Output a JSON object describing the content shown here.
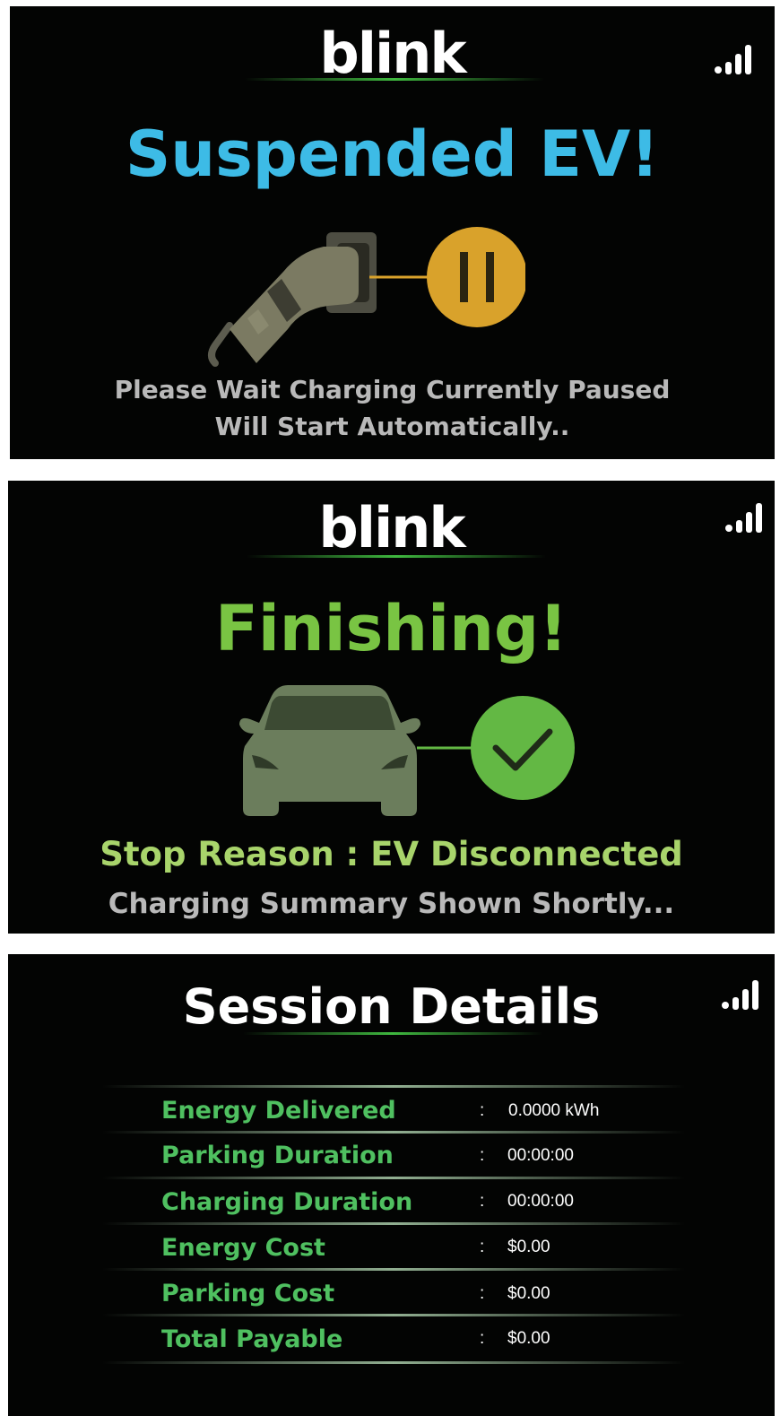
{
  "colors": {
    "panel_bg": "#030403",
    "brand_green": "#3fb83f",
    "suspended_blue": "#3dbbe6",
    "finishing_green": "#79c443",
    "stop_reason_green": "#a8d46b",
    "pause_amber": "#d9a22b",
    "check_green": "#63b844",
    "label_green": "#4fc060",
    "subtext_gray": "#b9b9b9"
  },
  "screens": {
    "suspended": {
      "logo": "blink",
      "title": "Suspended EV!",
      "message_line1": "Please Wait Charging Currently Paused",
      "message_line2": "Will Start Automatically..",
      "icons": [
        "signal-strength-icon",
        "ev-connector-icon",
        "pause-icon"
      ]
    },
    "finishing": {
      "logo": "blink",
      "title": "Finishing!",
      "stop_reason": "Stop Reason : EV Disconnected",
      "message": "Charging Summary Shown Shortly...",
      "icons": [
        "signal-strength-icon",
        "car-icon",
        "checkmark-icon"
      ]
    },
    "session_details": {
      "title": "Session Details",
      "separator": ":",
      "rows": [
        {
          "label": "Energy Delivered",
          "value": "0.0000 kWh"
        },
        {
          "label": "Parking Duration",
          "value": "00:00:00"
        },
        {
          "label": "Charging Duration",
          "value": "00:00:00"
        },
        {
          "label": "Energy Cost",
          "value": "$0.00"
        },
        {
          "label": "Parking Cost",
          "value": "$0.00"
        },
        {
          "label": "Total Payable",
          "value": "$0.00"
        }
      ],
      "icons": [
        "signal-strength-icon"
      ]
    }
  }
}
